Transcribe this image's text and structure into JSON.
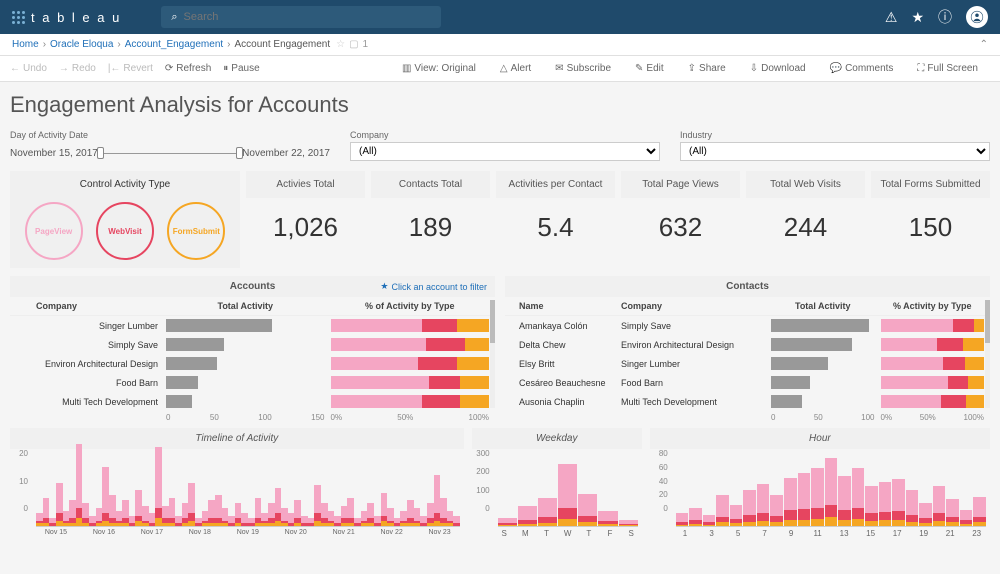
{
  "header": {
    "logo": "t a b l e a u",
    "search_placeholder": "Search"
  },
  "breadcrumb": {
    "items": [
      "Home",
      "Oracle Eloqua",
      "Account_Engagement"
    ],
    "current": "Account Engagement",
    "views": "1"
  },
  "toolbar": {
    "undo": "Undo",
    "redo": "Redo",
    "revert": "Revert",
    "refresh": "Refresh",
    "pause": "Pause",
    "view": "View: Original",
    "alert": "Alert",
    "subscribe": "Subscribe",
    "edit": "Edit",
    "share": "Share",
    "download": "Download",
    "comments": "Comments",
    "fullscreen": "Full Screen"
  },
  "title": "Engagement Analysis for Accounts",
  "filters": {
    "date_label": "Day of Activity Date",
    "date_start": "November 15, 2017",
    "date_end": "November 22, 2017",
    "company_label": "Company",
    "company_value": "(All)",
    "industry_label": "Industry",
    "industry_value": "(All)"
  },
  "control": {
    "title": "Control Activity Type",
    "pv": "PageView",
    "wv": "WebVisit",
    "fs": "FormSubmit"
  },
  "kpis": [
    {
      "label": "Activies Total",
      "value": "1,026"
    },
    {
      "label": "Contacts Total",
      "value": "189"
    },
    {
      "label": "Activities per Contact",
      "value": "5.4"
    },
    {
      "label": "Total Page Views",
      "value": "632"
    },
    {
      "label": "Total Web Visits",
      "value": "244"
    },
    {
      "label": "Total Forms Submitted",
      "value": "150"
    }
  ],
  "accounts": {
    "title": "Accounts",
    "hint": "Click an account to filter",
    "cols": {
      "company": "Company",
      "total": "Total Activity",
      "pct": "% of Activity by Type"
    },
    "rows": [
      {
        "company": "Singer Lumber",
        "total": 100,
        "pv": 58,
        "wv": 22,
        "fs": 20
      },
      {
        "company": "Simply Save",
        "total": 55,
        "pv": 60,
        "wv": 25,
        "fs": 15
      },
      {
        "company": "Environ Architectural Design",
        "total": 48,
        "pv": 55,
        "wv": 25,
        "fs": 20
      },
      {
        "company": "Food Barn",
        "total": 30,
        "pv": 62,
        "wv": 20,
        "fs": 18
      },
      {
        "company": "Multi Tech Development",
        "total": 25,
        "pv": 58,
        "wv": 24,
        "fs": 18
      }
    ],
    "xticks_bar": [
      "0",
      "50",
      "100",
      "150"
    ],
    "xticks_pct": [
      "0%",
      "50%",
      "100%"
    ]
  },
  "contacts": {
    "title": "Contacts",
    "cols": {
      "name": "Name",
      "company": "Company",
      "total": "Total Activity",
      "pct": "% Activity by Type"
    },
    "rows": [
      {
        "name": "Amankaya Colón",
        "company": "Simply Save",
        "total": 95,
        "pv": 70,
        "wv": 20,
        "fs": 10
      },
      {
        "name": "Delta Chew",
        "company": "Environ Architectural Design",
        "total": 78,
        "pv": 55,
        "wv": 25,
        "fs": 20
      },
      {
        "name": "Elsy Britt",
        "company": "Singer Lumber",
        "total": 55,
        "pv": 60,
        "wv": 22,
        "fs": 18
      },
      {
        "name": "Cesáreo Beauchesne",
        "company": "Food Barn",
        "total": 38,
        "pv": 65,
        "wv": 20,
        "fs": 15
      },
      {
        "name": "Ausonia Chaplin",
        "company": "Multi Tech Development",
        "total": 30,
        "pv": 58,
        "wv": 25,
        "fs": 17
      }
    ],
    "xticks_bar": [
      "0",
      "50",
      "100"
    ],
    "xticks_pct": [
      "0%",
      "50%",
      "100%"
    ]
  },
  "chart_data": [
    {
      "type": "bar",
      "title": "Timeline of Activity",
      "ylim": [
        0,
        25
      ],
      "yticks": [
        "20",
        "10",
        "0"
      ],
      "xlabels": [
        "Nov 15",
        "Nov 16",
        "Nov 17",
        "Nov 18",
        "Nov 19",
        "Nov 20",
        "Nov 21",
        "Nov 22",
        "Nov 23"
      ],
      "series": [
        {
          "name": "PageView",
          "color": "#f5a6c4"
        },
        {
          "name": "WebVisit",
          "color": "#e64560"
        },
        {
          "name": "FormSubmit",
          "color": "#f5a623"
        }
      ],
      "stacks": [
        [
          3,
          1,
          1
        ],
        [
          8,
          2,
          1
        ],
        [
          2,
          1,
          0
        ],
        [
          12,
          3,
          2
        ],
        [
          4,
          1,
          1
        ],
        [
          7,
          2,
          1
        ],
        [
          25,
          4,
          3
        ],
        [
          6,
          2,
          1
        ],
        [
          3,
          1,
          0
        ],
        [
          5,
          1,
          1
        ],
        [
          18,
          3,
          2
        ],
        [
          9,
          2,
          1
        ],
        [
          4,
          1,
          1
        ],
        [
          7,
          2,
          1
        ],
        [
          3,
          1,
          0
        ],
        [
          10,
          2,
          2
        ],
        [
          6,
          1,
          1
        ],
        [
          4,
          1,
          0
        ],
        [
          24,
          4,
          3
        ],
        [
          5,
          2,
          1
        ],
        [
          8,
          2,
          1
        ],
        [
          3,
          1,
          0
        ],
        [
          6,
          2,
          1
        ],
        [
          12,
          3,
          2
        ],
        [
          2,
          1,
          0
        ],
        [
          4,
          1,
          1
        ],
        [
          7,
          2,
          1
        ],
        [
          9,
          2,
          1
        ],
        [
          5,
          1,
          1
        ],
        [
          3,
          1,
          0
        ],
        [
          6,
          2,
          1
        ],
        [
          4,
          1,
          0
        ],
        [
          2,
          1,
          0
        ],
        [
          8,
          2,
          1
        ],
        [
          3,
          1,
          1
        ],
        [
          6,
          2,
          1
        ],
        [
          10,
          3,
          2
        ],
        [
          5,
          1,
          1
        ],
        [
          4,
          1,
          0
        ],
        [
          7,
          2,
          1
        ],
        [
          3,
          1,
          0
        ],
        [
          2,
          1,
          0
        ],
        [
          11,
          3,
          2
        ],
        [
          6,
          2,
          1
        ],
        [
          4,
          1,
          1
        ],
        [
          3,
          1,
          0
        ],
        [
          5,
          2,
          1
        ],
        [
          8,
          2,
          1
        ],
        [
          2,
          1,
          0
        ],
        [
          4,
          1,
          1
        ],
        [
          6,
          2,
          1
        ],
        [
          3,
          1,
          0
        ],
        [
          9,
          2,
          2
        ],
        [
          5,
          1,
          1
        ],
        [
          2,
          1,
          0
        ],
        [
          4,
          1,
          1
        ],
        [
          7,
          2,
          1
        ],
        [
          5,
          1,
          1
        ],
        [
          3,
          1,
          0
        ],
        [
          6,
          2,
          1
        ],
        [
          15,
          3,
          2
        ],
        [
          8,
          2,
          1
        ],
        [
          4,
          1,
          1
        ],
        [
          3,
          1,
          0
        ]
      ]
    },
    {
      "type": "bar",
      "title": "Weekday",
      "ylim": [
        0,
        320
      ],
      "yticks": [
        "300",
        "200",
        "100",
        "0"
      ],
      "xlabels": [
        "S",
        "M",
        "T",
        "W",
        "T",
        "F",
        "S"
      ],
      "stacks": [
        [
          25,
          8,
          5
        ],
        [
          70,
          20,
          12
        ],
        [
          95,
          28,
          15
        ],
        [
          220,
          55,
          35
        ],
        [
          110,
          30,
          20
        ],
        [
          50,
          15,
          10
        ],
        [
          20,
          6,
          4
        ]
      ]
    },
    {
      "type": "bar",
      "title": "Hour",
      "ylim": [
        0,
        90
      ],
      "yticks": [
        "80",
        "60",
        "40",
        "20",
        "0"
      ],
      "xlabels": [
        "1",
        "3",
        "5",
        "7",
        "9",
        "11",
        "13",
        "15",
        "17",
        "19",
        "21",
        "23"
      ],
      "stacks": [
        [
          12,
          4,
          2
        ],
        [
          18,
          5,
          3
        ],
        [
          10,
          3,
          2
        ],
        [
          30,
          8,
          5
        ],
        [
          20,
          6,
          4
        ],
        [
          35,
          10,
          6
        ],
        [
          40,
          12,
          7
        ],
        [
          30,
          9,
          5
        ],
        [
          45,
          14,
          8
        ],
        [
          50,
          15,
          9
        ],
        [
          55,
          16,
          10
        ],
        [
          65,
          18,
          12
        ],
        [
          48,
          14,
          8
        ],
        [
          55,
          16,
          10
        ],
        [
          38,
          11,
          7
        ],
        [
          42,
          12,
          8
        ],
        [
          45,
          13,
          8
        ],
        [
          35,
          10,
          6
        ],
        [
          22,
          7,
          4
        ],
        [
          38,
          11,
          7
        ],
        [
          25,
          8,
          5
        ],
        [
          15,
          5,
          3
        ],
        [
          28,
          8,
          5
        ]
      ]
    }
  ]
}
